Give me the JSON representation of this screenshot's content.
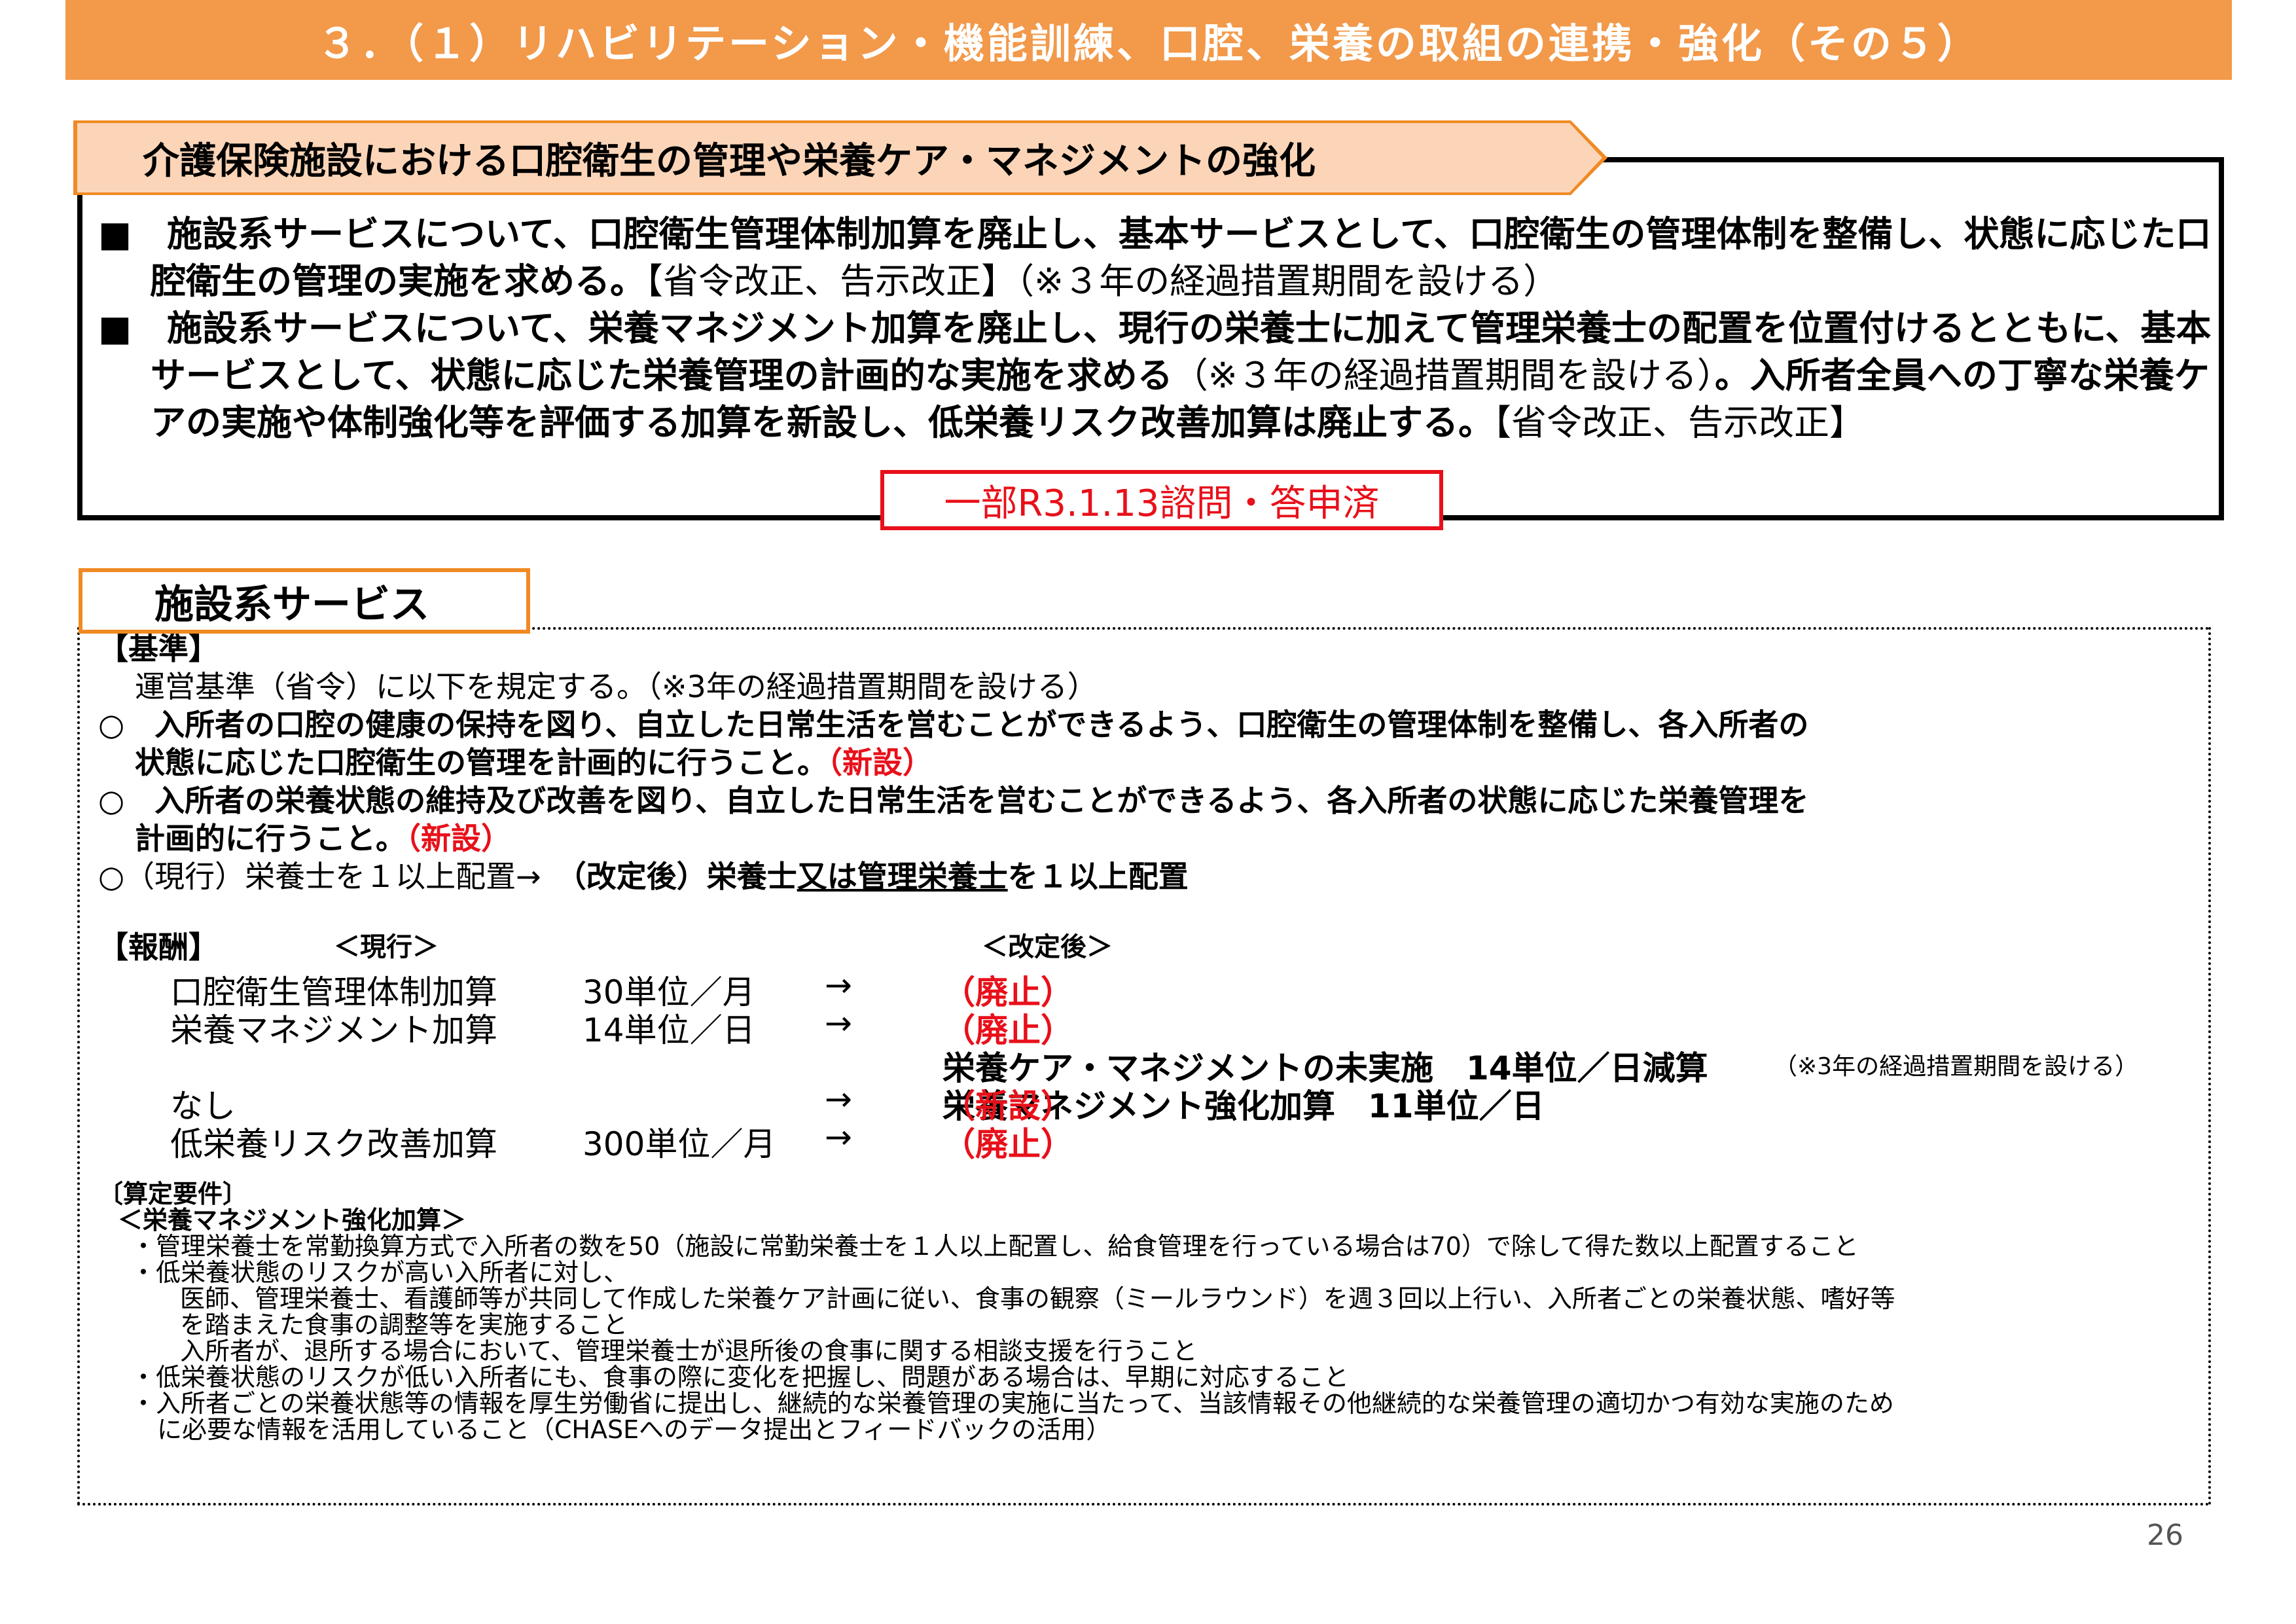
{
  "title": "３．（１）リハビリテーション・機能訓練、口腔、栄養の取組の連携・強化（その５）",
  "section_title": "介護保険施設における口腔衛生の管理や栄養ケア・マネジメントの強化",
  "summary": {
    "p1_bullet": "■　",
    "p1_bold": "施設系サービスについて、口腔衛生管理体制加算を廃止し、基本サービスとして、口腔衛生の管理体制を整備し、状態に応じた口腔衛生の管理の実施を求める。",
    "p1_normal": "【省令改正、告示改正】（※３年の経過措置期間を設ける）",
    "p2_bullet": "■　",
    "p2_bold": "施設系サービスについて、栄養マネジメント加算を廃止し、現行の栄養士に加えて管理栄養士の配置を位置付けるとともに、基本サービスとして、状態に応じた栄養管理の計画的な実施を求める",
    "p2_normal": "（※３年の経過措置期間を設ける）",
    "p2_bold2": "。入所者全員への丁寧な栄養ケアの実施や体制強化等を評価する加算を新設し、低栄養リスク改善加算は廃止する。",
    "p2_normal2": "【省令改正、告示改正】"
  },
  "stamp": "一部R3.1.13諮問・答申済",
  "facility_tab": "施設系サービス",
  "standards": {
    "heading": "【基準】",
    "intro": "運営基準（省令）に以下を規定する。（※3年の経過措置期間を設ける）",
    "item1_a": "○　入所者の口腔の健康の保持を図り、自立した日常生活を営むことができるよう、口腔衛生の管理体制を整備し、各入所者の",
    "item1_b": "状態に応じた口腔衛生の管理を計画的に行うこと。",
    "item1_new": "（新設）",
    "item2_a": "○　入所者の栄養状態の維持及び改善を図り、自立した日常生活を営むことができるよう、各入所者の状態に応じた栄養管理を",
    "item2_b": "計画的に行うこと。",
    "item2_new": "（新設）",
    "item3_prefix": "○（現行）栄養士を１以上配置→　",
    "item3_after_label": "（改定後）栄養士",
    "item3_underlined": "又は管理栄養士",
    "item3_suffix": "を１以上配置"
  },
  "remuneration": {
    "heading": "【報酬】",
    "current_label": "＜現行＞",
    "revised_label": "＜改定後＞",
    "rows": [
      {
        "name": "口腔衛生管理体制加算",
        "amount": "30単位／月",
        "arrow": "→",
        "result": "（廃止）"
      },
      {
        "name": "栄養マネジメント加算",
        "amount": "14単位／日",
        "arrow": "→",
        "result": "（廃止）"
      }
    ],
    "extra_line": "栄養ケア・マネジメントの未実施　14単位／日減算",
    "extra_note": "（※3年の経過措置期間を設ける）",
    "none_label": "なし",
    "none_arrow": "→",
    "new_addition": "栄養マネジメント強化加算　11単位／日",
    "new_tag": "（新設）",
    "last_row": {
      "name": "低栄養リスク改善加算",
      "amount": "300単位／月",
      "arrow": "→",
      "result": "（廃止）"
    }
  },
  "requirements": {
    "heading": "〔算定要件〕",
    "subheading": "＜栄養マネジメント強化加算＞",
    "lines": [
      "・管理栄養士を常勤換算方式で入所者の数を50（施設に常勤栄養士を１人以上配置し、給食管理を行っている場合は70）で除して得た数以上配置すること",
      "・低栄養状態のリスクが高い入所者に対し、",
      "医師、管理栄養士、看護師等が共同して作成した栄養ケア計画に従い、食事の観察（ミールラウンド）を週３回以上行い、入所者ごとの栄養状態、嗜好等",
      "を踏まえた食事の調整等を実施すること",
      "入所者が、退所する場合において、管理栄養士が退所後の食事に関する相談支援を行うこと",
      "・低栄養状態のリスクが低い入所者にも、食事の際に変化を把握し、問題がある場合は、早期に対応すること",
      "・入所者ごとの栄養状態等の情報を厚生労働省に提出し、継続的な栄養管理の実施に当たって、当該情報その他継続的な栄養管理の適切かつ有効な実施のため",
      "に必要な情報を活用していること（CHASEへのデータ提出とフィードバックの活用）"
    ]
  },
  "page_number": "26",
  "colors": {
    "accent": "#f2994a",
    "accent_light": "#fcd5b8",
    "red": "#e8101a"
  }
}
